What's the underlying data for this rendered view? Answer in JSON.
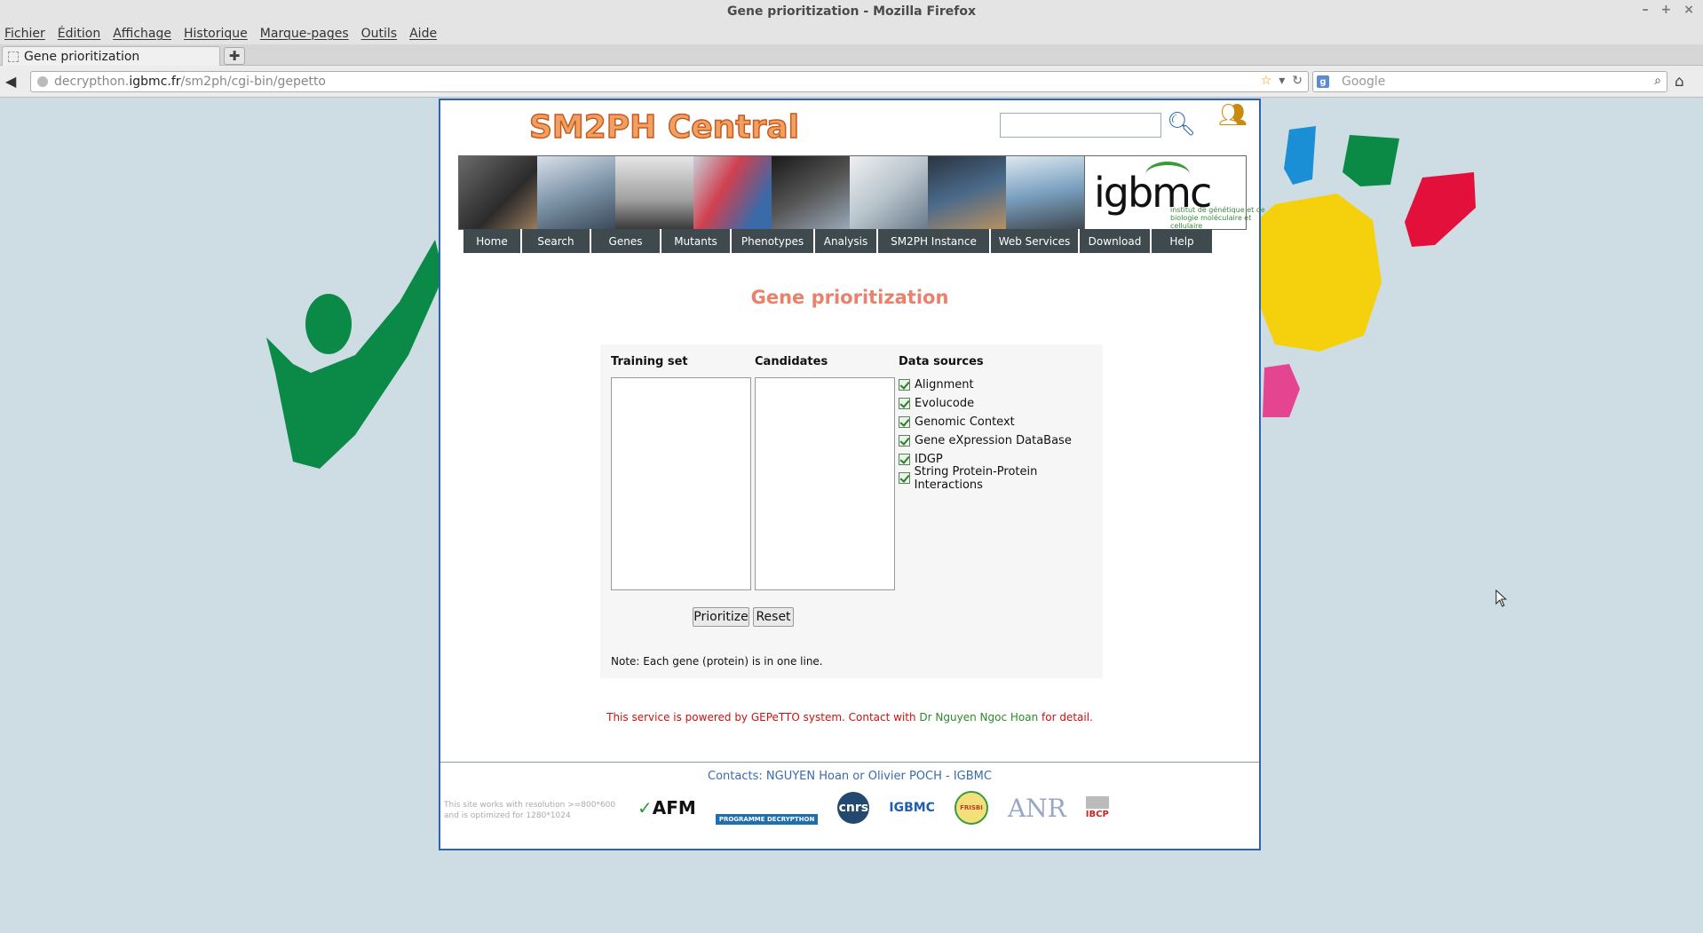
{
  "browser": {
    "window_title": "Gene prioritization - Mozilla Firefox",
    "window_controls": [
      "–",
      "+",
      "×"
    ],
    "menu": [
      "Fichier",
      "Édition",
      "Affichage",
      "Historique",
      "Marque-pages",
      "Outils",
      "Aide"
    ],
    "tab_title": "Gene prioritization",
    "url_prefix": "decrypthon.",
    "url_host": "igbmc.fr",
    "url_path": "/sm2ph/cgi-bin/gepetto",
    "search_placeholder": "Google"
  },
  "site": {
    "title": "SM2PH Central",
    "nav": [
      "Home",
      "Search",
      "Genes",
      "Mutants",
      "Phenotypes",
      "Analysis",
      "SM2PH Instance",
      "Web Services",
      "Download",
      "Help"
    ],
    "banner_logo_word": "igbmc",
    "banner_logo_sub": "institut de génétique et de biologie moléculaire et cellulaire"
  },
  "main": {
    "heading": "Gene prioritization",
    "training_label": "Training set",
    "candidates_label": "Candidates",
    "datasources_label": "Data sources",
    "data_sources": [
      "Alignment",
      "Evolucode",
      "Genomic Context",
      "Gene eXpression DataBase",
      "IDGP",
      "String Protein-Protein Interactions"
    ],
    "prioritize_label": "Prioritize",
    "reset_label": "Reset",
    "note": "Note: Each gene (protein) is in one line."
  },
  "powered": {
    "text1": "This service is powered by GEPeTTO system. Contact with ",
    "contact_name": "Dr Nguyen Ngoc Hoan",
    "text2": " for detail."
  },
  "footer": {
    "contacts": "Contacts: NGUYEN Hoan or Olivier POCH - IGBMC",
    "resolution_note_1": "This site works with resolution >=800*600",
    "resolution_note_2": "and is optimized for 1280*1024",
    "sponsors": [
      "AFM",
      "PROGRAMME DECRYPTHON",
      "cnrs",
      "IGBMC",
      "FRISBI",
      "ANR",
      "IBCP"
    ]
  },
  "colors": {
    "page_bg": "#cddde3",
    "nav_bg": "#3f4a4f",
    "heading": "#e8826a",
    "frame_border": "#2e62b5",
    "powered_red": "#cc1111",
    "powered_green": "#2a8a2a"
  }
}
